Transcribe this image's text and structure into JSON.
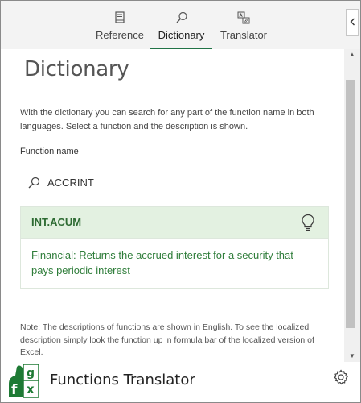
{
  "tabs": [
    {
      "label": "Reference",
      "icon": "book-icon",
      "active": false
    },
    {
      "label": "Dictionary",
      "icon": "search-icon",
      "active": true
    },
    {
      "label": "Translator",
      "icon": "translate-icon",
      "active": false
    }
  ],
  "page": {
    "title": "Dictionary",
    "intro": "With the dictionary you can search for any part of the function name in both languages. Select a function and the description is shown.",
    "function_name_label": "Function name"
  },
  "search": {
    "value": "ACCRINT",
    "placeholder": ""
  },
  "result": {
    "name": "INT.ACUM",
    "description": "Financial: Returns the accrued interest for a security that pays periodic interest"
  },
  "note": "Note: The descriptions of functions are shown in English. To see the localized description simply look the function up in formula bar of the localized version of Excel.",
  "footer": {
    "app_title": "Functions Translator",
    "logo_letters": [
      "f",
      "g",
      "x"
    ]
  },
  "colors": {
    "accent": "#217346",
    "card_header_bg": "#e3f1e1",
    "card_text": "#2f7d3a"
  }
}
